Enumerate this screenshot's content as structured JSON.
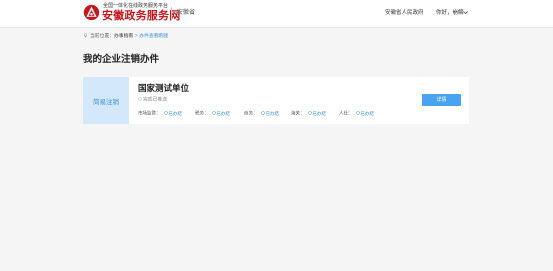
{
  "header": {
    "logo_subtitle": "全国一体化在线政务服务平台",
    "logo_title": "安徽政务服务网",
    "region": "安徽省",
    "gov_link": "安徽省人民政府",
    "user_greeting": "你好，崩解",
    "brand_color": "#c8161d"
  },
  "breadcrumb": {
    "prefix": "当前位置：",
    "items": [
      "办事指南",
      "办件查看跑腿"
    ],
    "separator": ">"
  },
  "page": {
    "title": "我的企业注销办件"
  },
  "card": {
    "tag": "简易注销",
    "unit_name": "国家测试单位",
    "status": "完成已推送",
    "detail_button": "详情",
    "fields": [
      {
        "label": "市场监管：",
        "value": "已办结"
      },
      {
        "label": "税务：",
        "value": "已办结"
      },
      {
        "label": "商务：",
        "value": "已办结"
      },
      {
        "label": "海关：",
        "value": "已办结"
      },
      {
        "label": "人社：",
        "value": "已办结"
      }
    ]
  },
  "colors": {
    "accent": "#3a8fd9",
    "button": "#4aa3f0",
    "tag_bg": "#d4e8fb"
  }
}
